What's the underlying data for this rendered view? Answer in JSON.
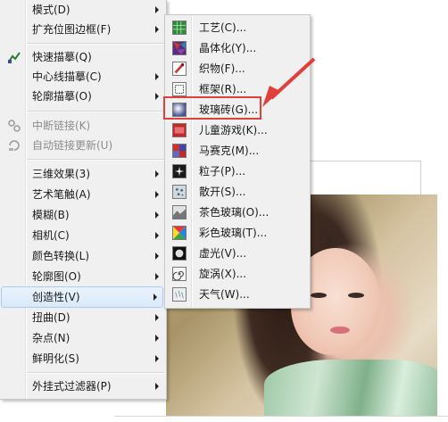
{
  "main_menu": {
    "items": [
      {
        "label": "模式(D)",
        "arrow": true
      },
      {
        "label": "扩充位图边框(F)",
        "arrow": true
      },
      {
        "label": "快速描摹(Q)",
        "arrow": false
      },
      {
        "label": "中心线描摹(C)",
        "arrow": true
      },
      {
        "label": "轮廓描摹(O)",
        "arrow": true
      },
      {
        "label": "中断链接(K)",
        "arrow": false,
        "disabled": true
      },
      {
        "label": "自动链接更新(U)",
        "arrow": false,
        "disabled": true
      },
      {
        "label": "三维效果(3)",
        "arrow": true
      },
      {
        "label": "艺术笔触(A)",
        "arrow": true
      },
      {
        "label": "模糊(B)",
        "arrow": true
      },
      {
        "label": "相机(C)",
        "arrow": true
      },
      {
        "label": "颜色转换(L)",
        "arrow": true
      },
      {
        "label": "轮廓图(O)",
        "arrow": true
      },
      {
        "label": "创造性(V)",
        "arrow": true,
        "highlight": true
      },
      {
        "label": "扭曲(D)",
        "arrow": true
      },
      {
        "label": "杂点(N)",
        "arrow": true
      },
      {
        "label": "鲜明化(S)",
        "arrow": true
      },
      {
        "label": "外挂式过滤器(P)",
        "arrow": true
      }
    ]
  },
  "sub_menu": {
    "items": [
      {
        "label": "工艺(C)...",
        "icon": "crafts-icon",
        "color": "#4caf50"
      },
      {
        "label": "晶体化(Y)...",
        "icon": "crystallize-icon",
        "color": "#8a2ea0"
      },
      {
        "label": "织物(F)...",
        "icon": "fabric-icon",
        "color": "#d32f2f"
      },
      {
        "label": "框架(R)...",
        "icon": "frame-icon",
        "color": "#555555"
      },
      {
        "label": "玻璃砖(G)...",
        "icon": "glass-block-icon",
        "color": "#6f7aa8"
      },
      {
        "label": "儿童游戏(K)...",
        "icon": "kids-play-icon",
        "color": "#c62828"
      },
      {
        "label": "马赛克(M)...",
        "icon": "mosaic-icon",
        "color": "#3949ab"
      },
      {
        "label": "粒子(P)...",
        "icon": "particles-icon",
        "color": "#202020"
      },
      {
        "label": "散开(S)...",
        "icon": "scatter-icon",
        "color": "#7a8a9a"
      },
      {
        "label": "茶色玻璃(O)...",
        "icon": "smoked-glass-icon",
        "color": "#8d8d8d"
      },
      {
        "label": "彩色玻璃(T)...",
        "icon": "stained-glass-icon",
        "color": "#e53935"
      },
      {
        "label": "虚光(V)...",
        "icon": "vignette-icon",
        "color": "#101010"
      },
      {
        "label": "旋涡(X)...",
        "icon": "vortex-icon",
        "color": "#6d6d6d"
      },
      {
        "label": "天气(W)...",
        "icon": "weather-icon",
        "color": "#9aa8b5"
      }
    ]
  },
  "accent": {
    "highlight_border": "#a8cdf0",
    "annotation": "#e0403a"
  }
}
